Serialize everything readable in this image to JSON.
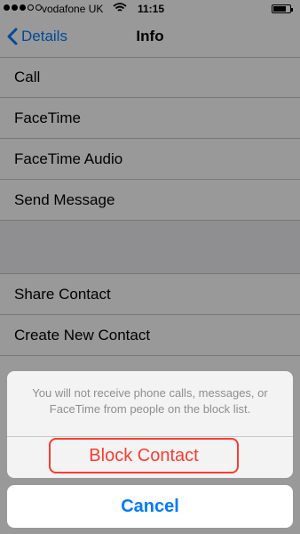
{
  "status_bar": {
    "carrier": "vodafone UK",
    "time": "11:15",
    "signal_strength": 3,
    "battery_level": 0.8
  },
  "nav": {
    "back_label": "Details",
    "title": "Info"
  },
  "list": {
    "group1": [
      "Call",
      "FaceTime",
      "FaceTime Audio",
      "Send Message"
    ],
    "group2": [
      "Share Contact",
      "Create New Contact"
    ]
  },
  "action_sheet": {
    "message": "You will not receive phone calls, messages, or FaceTime from people on the block list.",
    "block_label": "Block Contact",
    "cancel_label": "Cancel"
  },
  "colors": {
    "accent": "#007aff",
    "destructive": "#ff3b30",
    "overlay": "#000000"
  }
}
